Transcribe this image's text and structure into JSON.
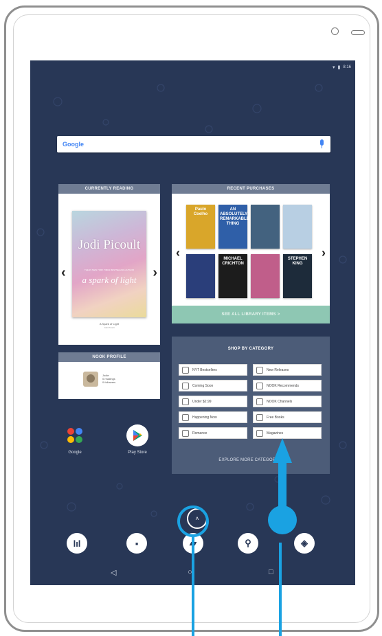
{
  "status_bar": {
    "time": "8:16",
    "wifi_icon": "wifi-icon",
    "battery_icon": "battery-icon"
  },
  "search": {
    "brand": "Google",
    "mic_icon": "mic-icon"
  },
  "currently_reading": {
    "header": "CURRENTLY READING",
    "book_author": "Jodi Picoult",
    "book_title": "a spark of light",
    "cover_tagline": "THE #1 NEW YORK TIMES BESTSELLING AUTHOR",
    "caption_title": "A Spark of Light",
    "caption_author": "Jodi Picoult"
  },
  "nook_profile": {
    "header": "NOOK PROFILE",
    "name": "Jodie",
    "line1": "0 readings",
    "line2": "0 followers"
  },
  "recent_purchases": {
    "header": "RECENT PURCHASES",
    "books": [
      {
        "text": "Paulo Coelho",
        "color": "#d9a62a"
      },
      {
        "text": "AN ABSOLUTELY REMARKABLE THING",
        "color": "#2f5fa8"
      },
      {
        "text": "",
        "color": "#43627f"
      },
      {
        "text": "",
        "color": "#b8cfe3"
      },
      {
        "text": "",
        "color": "#2a3e7a"
      },
      {
        "text": "MICHAEL CRICHTON",
        "color": "#1c1c1c"
      },
      {
        "text": "",
        "color": "#c05e8a"
      },
      {
        "text": "STEPHEN KING",
        "color": "#1d2b3a"
      }
    ],
    "see_all": "SEE ALL LIBRARY ITEMS >"
  },
  "shop_by_category": {
    "header": "SHOP BY CATEGORY",
    "categories": [
      {
        "label": "NYT Bestsellers",
        "icon": "list-icon"
      },
      {
        "label": "New Releases",
        "icon": "document-icon"
      },
      {
        "label": "Coming Soon",
        "icon": "calendar-icon"
      },
      {
        "label": "NOOK Recommends",
        "icon": "badge-icon"
      },
      {
        "label": "Under $2.99",
        "icon": "tag-icon"
      },
      {
        "label": "NOOK Channels",
        "icon": "channel-icon"
      },
      {
        "label": "Happening Now",
        "icon": "bulb-icon"
      },
      {
        "label": "Free Books",
        "icon": "free-icon"
      },
      {
        "label": "Romance",
        "icon": "heart-icon"
      },
      {
        "label": "Magazines",
        "icon": "magazine-icon"
      }
    ],
    "explore": "EXPLORE MORE CATEGORIES"
  },
  "apps": [
    {
      "label": "Google",
      "icon": "google-folder-icon"
    },
    {
      "label": "Play Store",
      "icon": "play-store-icon"
    }
  ],
  "dock": [
    "library-icon",
    "shop-bag-icon",
    "nook-icon",
    "search-icon",
    "nook-logo-icon"
  ],
  "nav": {
    "back": "◁",
    "home": "○",
    "recents": "□"
  },
  "colors": {
    "screen_bg": "#283756",
    "accent_blue": "#1aa2e2",
    "see_all_green": "#8ec7b3"
  }
}
